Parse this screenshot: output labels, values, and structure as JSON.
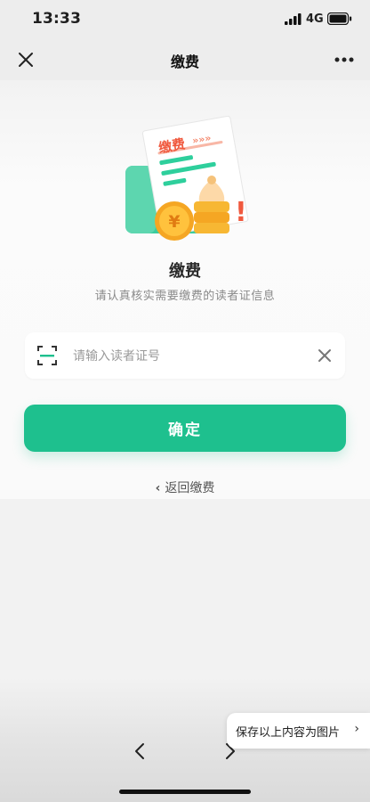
{
  "status_bar": {
    "time": "13:33",
    "network": "4G",
    "signal_icon": "signal-bars-icon",
    "battery_icon": "battery-icon"
  },
  "nav": {
    "title": "缴费",
    "close_icon": "close-icon",
    "more_icon": "more-icon"
  },
  "illustration": {
    "name": "payment-bill-illustration",
    "bill_label": "缴费",
    "chevrons": "»»»",
    "currency_symbol": "¥",
    "exclamation": "!"
  },
  "main": {
    "heading": "缴费",
    "subtitle": "请认真核实需要缴费的读者证信息",
    "reader_input": {
      "placeholder": "请输入读者证号",
      "value": ""
    },
    "confirm_label": "确定",
    "back_label": "返回缴费"
  },
  "toolbar": {
    "back_icon": "back-arrow-icon",
    "forward_icon": "forward-arrow-icon",
    "save_image_label": "保存以上内容为图片"
  },
  "colors": {
    "accent": "#1ec08e",
    "bill_red": "#f0593e",
    "coin_orange": "#f5a623"
  }
}
